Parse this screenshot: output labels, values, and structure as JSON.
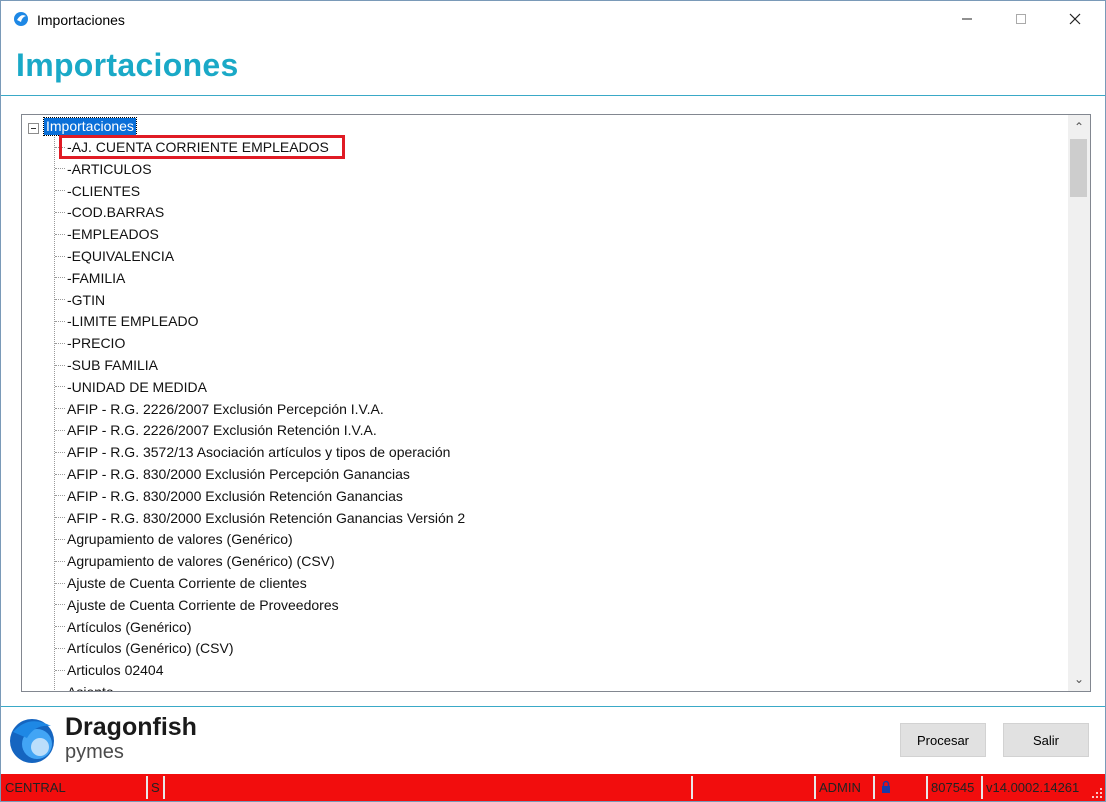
{
  "window": {
    "title": "Importaciones",
    "minimize_icon": "minimize-icon",
    "maximize_icon": "maximize-icon",
    "close_icon": "close-icon"
  },
  "header": {
    "title": "Importaciones"
  },
  "tree": {
    "root": "Importaciones",
    "highlighted_item": "-AJ. CUENTA CORRIENTE EMPLEADOS",
    "items": [
      "-AJ. CUENTA CORRIENTE EMPLEADOS",
      "-ARTICULOS",
      "-CLIENTES",
      "-COD.BARRAS",
      "-EMPLEADOS",
      "-EQUIVALENCIA",
      "-FAMILIA",
      "-GTIN",
      "-LIMITE EMPLEADO",
      "-PRECIO",
      "-SUB FAMILIA",
      "-UNIDAD DE MEDIDA",
      "AFIP - R.G. 2226/2007 Exclusión Percepción I.V.A.",
      "AFIP - R.G. 2226/2007 Exclusión Retención I.V.A.",
      "AFIP - R.G. 3572/13 Asociación artículos y tipos de operación",
      "AFIP - R.G. 830/2000 Exclusión Percepción Ganancias",
      "AFIP - R.G. 830/2000 Exclusión Retención Ganancias",
      "AFIP - R.G. 830/2000 Exclusión Retención Ganancias Versión 2",
      "Agrupamiento de valores (Genérico)",
      "Agrupamiento de valores (Genérico) (CSV)",
      "Ajuste de Cuenta Corriente de clientes",
      "Ajuste de Cuenta Corriente de Proveedores",
      "Artículos (Genérico)",
      "Artículos (Genérico) (CSV)",
      "Articulos 02404",
      "Asiento"
    ]
  },
  "branding": {
    "name": "Dragonfish",
    "sub": "pymes"
  },
  "buttons": {
    "procesar": "Procesar",
    "salir": "Salir"
  },
  "statusbar": {
    "branch": "CENTRAL",
    "s": "S",
    "user": "ADMIN",
    "code": "807545",
    "version": "v14.0002.14261",
    "lock_icon": "lock-icon",
    "color": "#f20d0d"
  },
  "colors": {
    "accent": "#1aa9c7",
    "selection": "#0a6fd8",
    "highlight_border": "#e01b24"
  }
}
